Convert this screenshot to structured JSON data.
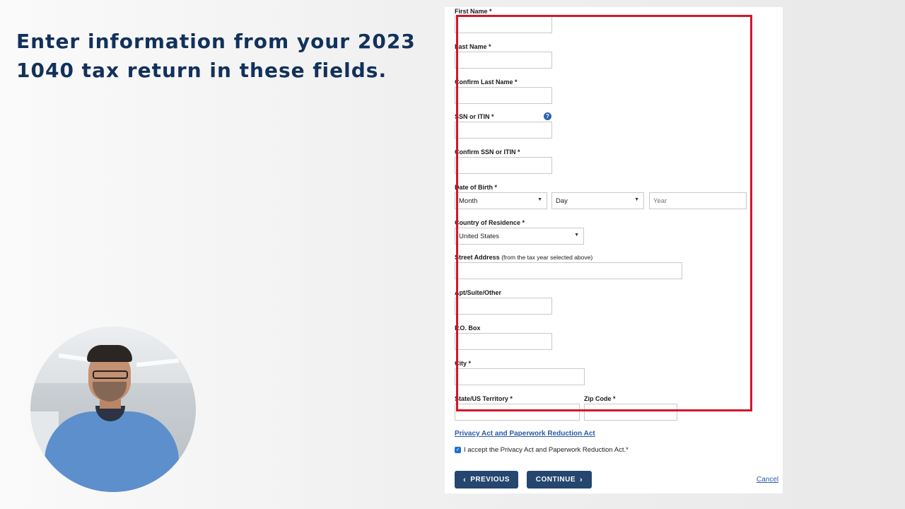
{
  "headline": {
    "line1": "Enter information from your 2023",
    "line2": "1040 tax return in these fields."
  },
  "form": {
    "first_name_label": "First Name *",
    "last_name_label": "Last Name *",
    "confirm_last_name_label": "Confirm Last Name *",
    "ssn_label": "SSN or ITIN *",
    "help_icon": "?",
    "confirm_ssn_label": "Confirm SSN or ITIN *",
    "dob_label": "Date of Birth *",
    "dob_month": "Month",
    "dob_day": "Day",
    "dob_year_placeholder": "Year",
    "country_label": "Country of Residence *",
    "country_value": "United States",
    "street_label": "Street Address",
    "street_sublabel": "(from the tax year selected above)",
    "apt_label": "Apt/Suite/Other",
    "pobox_label": "P.O. Box",
    "city_label": "City *",
    "state_label": "State/US Territory *",
    "zip_label": "Zip Code *",
    "privacy_link": "Privacy Act and Paperwork Reduction Act",
    "accept_text": "I accept the Privacy Act and Paperwork Reduction Act.*",
    "accept_checked": true,
    "previous_button": "PREVIOUS",
    "continue_button": "CONTINUE",
    "cancel_link": "Cancel"
  },
  "icons": {
    "dropdown_caret": "caret-down-icon",
    "prev_chevron": "chevron-left-icon",
    "next_chevron": "chevron-right-icon",
    "checkbox_mark": "checkmark-icon"
  },
  "colors": {
    "headline": "#12315a",
    "highlight": "#d3162a",
    "button": "#24466f",
    "link": "#2d5aa8"
  }
}
